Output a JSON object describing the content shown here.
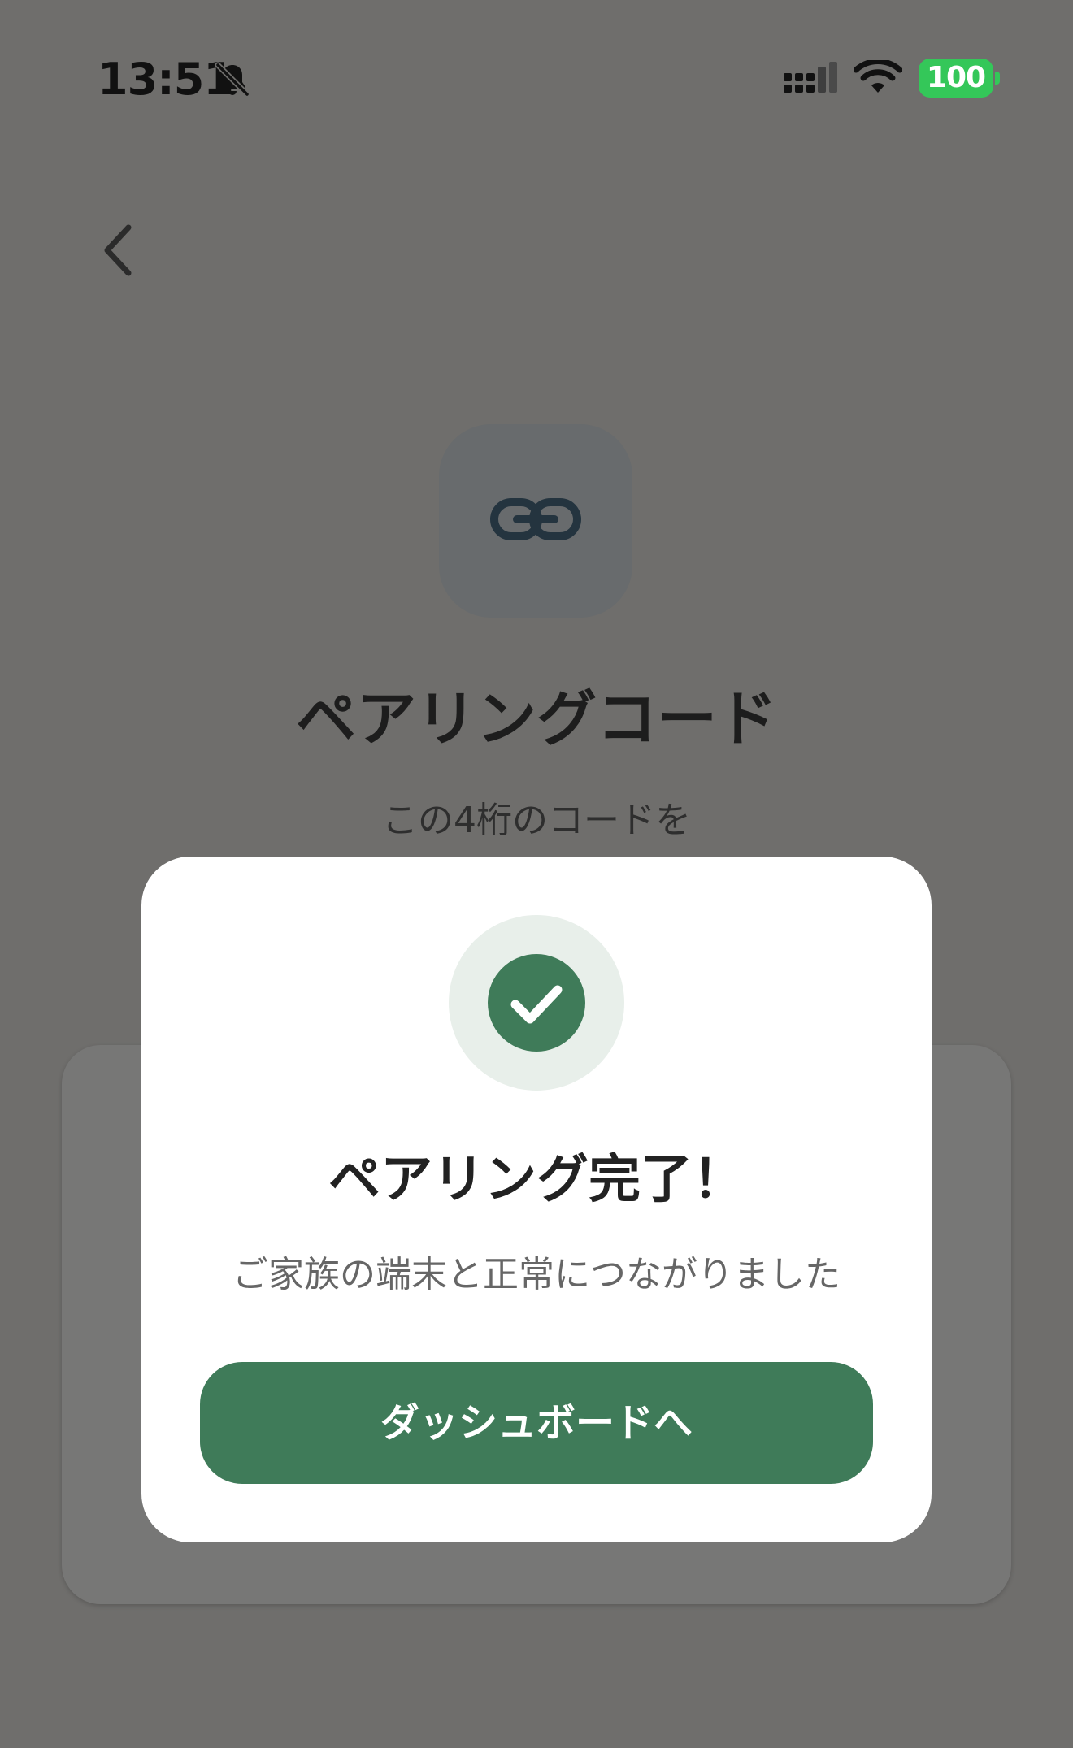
{
  "status_bar": {
    "time": "13:51",
    "battery": "100",
    "icons": [
      "bell-slash-icon",
      "cellular-signal-icon",
      "wifi-icon",
      "battery-icon"
    ]
  },
  "background_page": {
    "back_icon": "chevron-left-icon",
    "tile_icon": "link-icon",
    "title": "ペアリングコード",
    "subtitle": "この4桁のコードを"
  },
  "modal": {
    "icon": "check-circle-icon",
    "title": "ペアリング完了！",
    "message": "ご家族の端末と正常につながりました",
    "button_label": "ダッシュボードへ"
  },
  "colors": {
    "accent": "#3f7b59",
    "badge_background": "#e8efea",
    "battery": "#34c759",
    "overlay_background": "#6f6e6c"
  }
}
